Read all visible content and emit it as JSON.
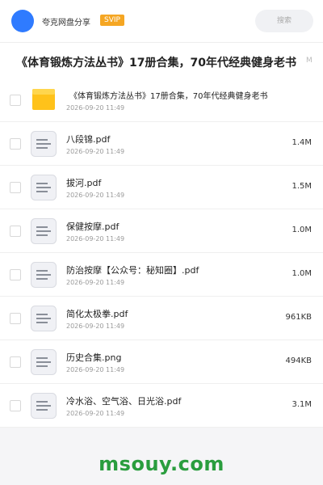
{
  "header": {
    "sharer_name": "夸克网盘分享",
    "badge": "SVIP",
    "search_placeholder": "搜索"
  },
  "title_bar": {
    "title": "《体育锻炼方法丛书》17册合集，70年代经典健身老书",
    "size": "M"
  },
  "files": [
    {
      "type": "folder",
      "icon": "folder-icon",
      "name": "《体育锻炼方法丛书》17册合集，70年代经典健身老书",
      "date": "2026-09-20 11:49",
      "size": ""
    },
    {
      "type": "file",
      "icon": "document-icon",
      "name": "八段锦.pdf",
      "date": "2026-09-20 11:49",
      "size": "1.4M"
    },
    {
      "type": "file",
      "icon": "document-icon",
      "name": "拔河.pdf",
      "date": "2026-09-20 11:49",
      "size": "1.5M"
    },
    {
      "type": "file",
      "icon": "document-icon",
      "name": "保健按摩.pdf",
      "date": "2026-09-20 11:49",
      "size": "1.0M"
    },
    {
      "type": "file",
      "icon": "document-icon",
      "name": "防治按摩【公众号：秘知圈】.pdf",
      "date": "2026-09-20 11:49",
      "size": "1.0M"
    },
    {
      "type": "file",
      "icon": "document-icon",
      "name": "简化太极拳.pdf",
      "date": "2026-09-20 11:49",
      "size": "961KB"
    },
    {
      "type": "file",
      "icon": "document-icon",
      "name": "历史合集.png",
      "date": "2026-09-20 11:49",
      "size": "494KB"
    },
    {
      "type": "file",
      "icon": "document-icon",
      "name": "冷水浴、空气浴、日光浴.pdf",
      "date": "2026-09-20 11:49",
      "size": "3.1M"
    }
  ],
  "watermark": "msouy.com",
  "colors": {
    "avatar": "#2f7bff",
    "svip": "#f5a623",
    "folder": "#ffc21a",
    "watermark": "#2a9d3e"
  }
}
